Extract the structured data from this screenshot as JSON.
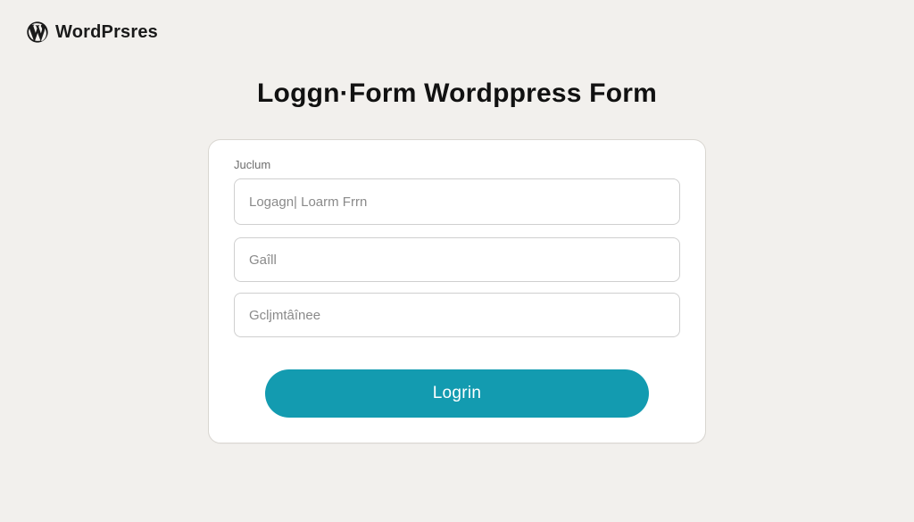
{
  "brand": {
    "name": "WordPrsres"
  },
  "page": {
    "title": "Loggn·Form Wordppress Form"
  },
  "form": {
    "field1": {
      "label": "Juclum",
      "placeholder": "Logagn| Loarm Frrn",
      "value": ""
    },
    "field2": {
      "placeholder": "Gaîll",
      "value": ""
    },
    "field3": {
      "placeholder": "Gcljmtâînee",
      "value": ""
    },
    "submit_label": "Logrin"
  },
  "colors": {
    "accent": "#139bb0",
    "background": "#f2f0ed"
  }
}
